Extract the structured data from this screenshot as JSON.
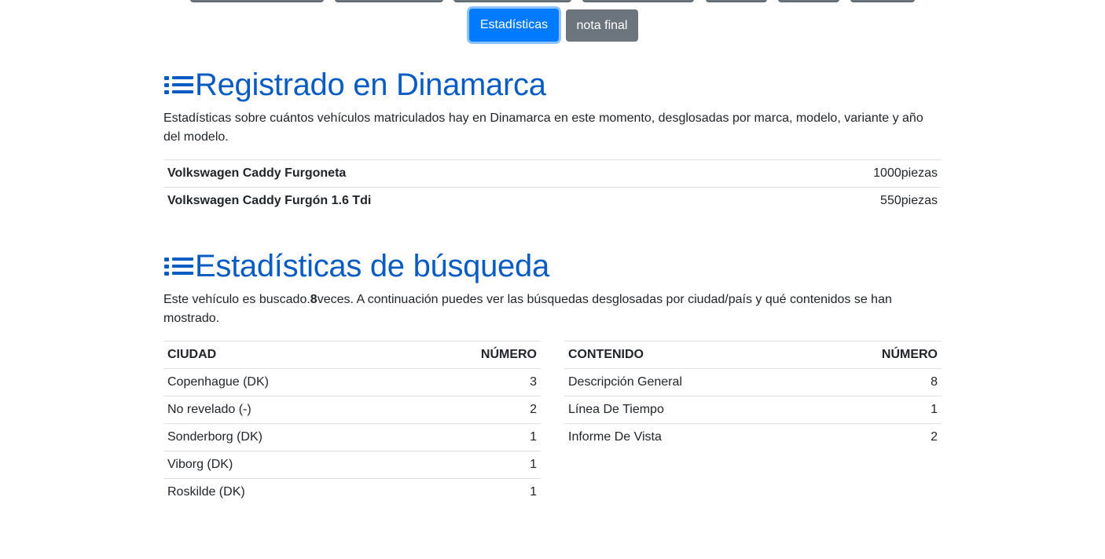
{
  "nav": {
    "stats_label": "Estadísticas",
    "final_label": "nota final"
  },
  "registered": {
    "title": "Registrado en Dinamarca",
    "description": "Estadísticas sobre cuántos vehículos matriculados hay en Dinamarca en este momento, desglosadas por marca, modelo, variante y año del modelo.",
    "rows": [
      {
        "name": "Volkswagen Caddy Furgoneta",
        "count": "1000piezas"
      },
      {
        "name": "Volkswagen Caddy Furgón 1.6 Tdi",
        "count": "550piezas"
      }
    ]
  },
  "search": {
    "title": "Estadísticas de búsqueda",
    "desc_prefix": "Este vehículo es buscado.",
    "desc_count": "8",
    "desc_suffix": "veces. A continuación puedes ver las búsquedas desglosadas por ciudad/país y qué contenidos se han mostrado.",
    "city_table": {
      "headers": [
        "CIUDAD",
        "NÚMERO"
      ],
      "rows": [
        {
          "label": "Copenhague (DK)",
          "value": "3"
        },
        {
          "label": "No revelado (-)",
          "value": "2"
        },
        {
          "label": "Sonderborg (DK)",
          "value": "1"
        },
        {
          "label": "Viborg (DK)",
          "value": "1"
        },
        {
          "label": "Roskilde (DK)",
          "value": "1"
        }
      ]
    },
    "content_table": {
      "headers": [
        "CONTENIDO",
        "NÚMERO"
      ],
      "rows": [
        {
          "label": "Descripción General",
          "value": "8"
        },
        {
          "label": "Línea De Tiempo",
          "value": "1"
        },
        {
          "label": "Informe De Vista",
          "value": "2"
        }
      ]
    }
  },
  "colors": {
    "accent": "#007bff",
    "heading": "#0a5cc2",
    "secondary": "#6c757d"
  }
}
